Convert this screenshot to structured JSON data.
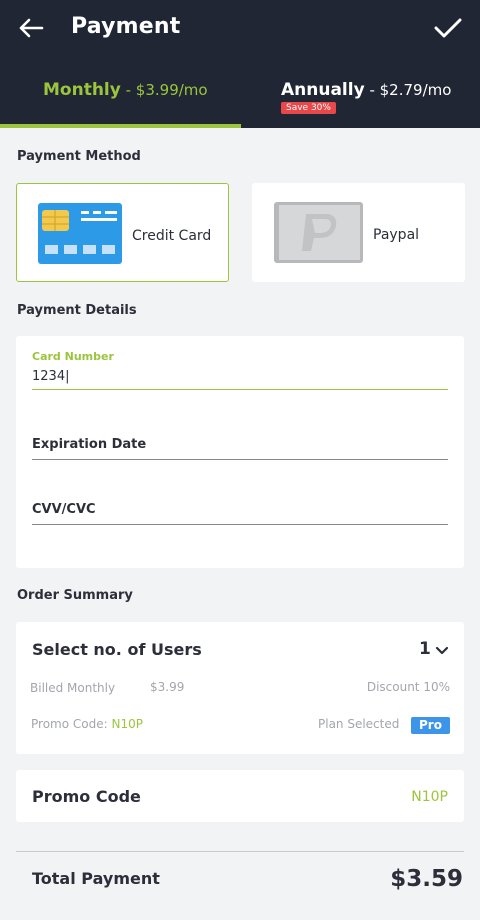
{
  "header": {
    "title": "Payment",
    "back_icon": "arrow-left-icon",
    "confirm_icon": "check-icon"
  },
  "plans": {
    "monthly": {
      "name": "Monthly",
      "price": " - $3.99/mo",
      "selected": true
    },
    "annually": {
      "name": "Annually",
      "price": " - $2.79/mo",
      "badge": "Save 30%"
    }
  },
  "payment_method": {
    "section_label": "Payment Method",
    "options": [
      {
        "label": "Credit Card",
        "icon": "credit-card-icon",
        "selected": true
      },
      {
        "label": "Paypal",
        "icon": "paypal-icon",
        "selected": false
      }
    ]
  },
  "payment_details": {
    "section_label": "Payment Details",
    "card_number": {
      "label": "Card Number",
      "value": "1234|"
    },
    "expiration": {
      "label": "Expiration Date",
      "value": ""
    },
    "cvv": {
      "label": "CVV/CVC",
      "value": ""
    }
  },
  "order_summary": {
    "section_label": "Order Summary",
    "users_label": "Select no. of Users",
    "users_value": "1",
    "billed_label": "Billed Monthly",
    "billed_amount": "$3.99",
    "discount_label": "Discount 10%",
    "promo_label": "Promo Code: ",
    "promo_code": "N10P",
    "plan_label": "Plan Selected",
    "plan_value": "Pro"
  },
  "promo": {
    "label": "Promo Code",
    "value": "N10P"
  },
  "total": {
    "label": "Total Payment",
    "value": "$3.59"
  },
  "colors": {
    "accent": "#9bc53d",
    "header_bg": "#202634",
    "badge_red": "#e8484a",
    "pro_blue": "#3c95e8"
  }
}
